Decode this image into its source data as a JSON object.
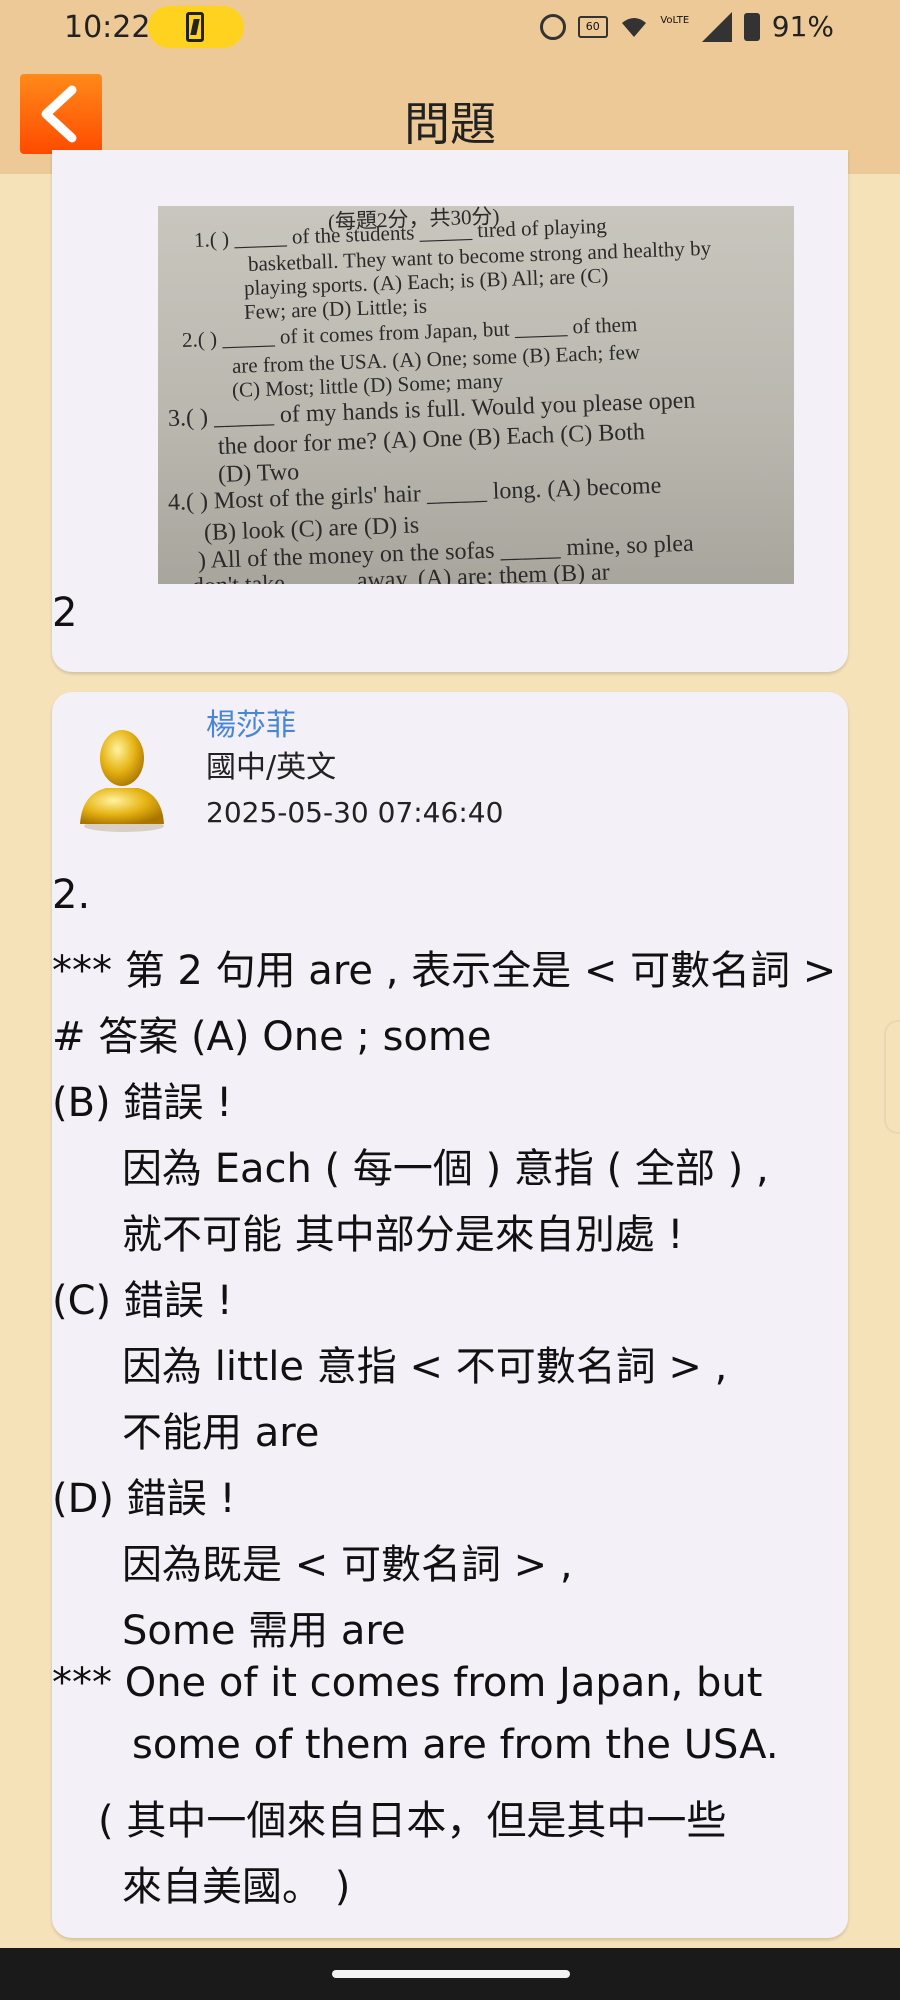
{
  "status_bar": {
    "time": "10:22",
    "battery_percent": "91%",
    "icons": [
      "battery-charging-icon",
      "alarm-icon",
      "refresh-rate-60hz-icon",
      "wifi-icon",
      "volte-icon",
      "signal-icon",
      "battery-icon"
    ],
    "hz_label": "60",
    "volte_label": "VoLTE"
  },
  "app_bar": {
    "title": "問題",
    "back_icon": "chevron-left-icon",
    "accent": "#ff6a00"
  },
  "question_card": {
    "photo_text_lines": [
      "(每題2分，共30分)",
      "1.(    ) _____ of the students _____ tired of playing",
      "basketball.  They want to become strong and healthy by",
      "playing sports.  (A) Each; is  (B) All; are  (C)",
      "Few; are  (D) Little; is",
      "2.(    ) _____ of it comes from Japan, but _____ of them",
      "are from the USA.  (A) One; some  (B) Each; few",
      "(C) Most; little  (D) Some; many",
      "3.(    ) _____ of my hands is full.  Would you please open",
      "the door for me?  (A) One  (B) Each  (C) Both",
      "(D) Two",
      "4.(    ) Most of the girls' hair _____ long.  (A) become",
      "(B) look  (C) are  (D) is",
      ") All of the money on the sofas _____ mine, so plea",
      "don't take _____ away.  (A) are; them  (B) ar"
    ],
    "answer_number": "2"
  },
  "answer_card": {
    "poster_name": "楊莎菲",
    "subject": "國中/英文",
    "timestamp": "2025-05-30 07:46:40",
    "avatar_icon": "user-avatar-icon",
    "lines": [
      "2.",
      "*** 第 2 句用 are , 表示全是 < 可數名詞 >",
      "# 答案 (A) One ; some",
      "(B) 錯誤 !",
      "因為 Each ( 每一個 ) 意指 ( 全部 ) ,",
      "就不可能 其中部分是來自別處 !",
      "(C) 錯誤 !",
      "因為 little 意指 < 不可數名詞 > ,",
      "不能用 are",
      "(D) 錯誤 !",
      "因為既是 < 可數名詞 > ,",
      "Some 需用 are",
      "*** One of it comes from Japan, but",
      "some of them are  from the USA.",
      "( 其中一個來自日本，但是其中一些",
      "來自美國。 )"
    ]
  },
  "colors": {
    "background": "#f6e2b8",
    "header": "#ecc996",
    "card": "#f4f0f8",
    "poster_name": "#4a86d6"
  }
}
